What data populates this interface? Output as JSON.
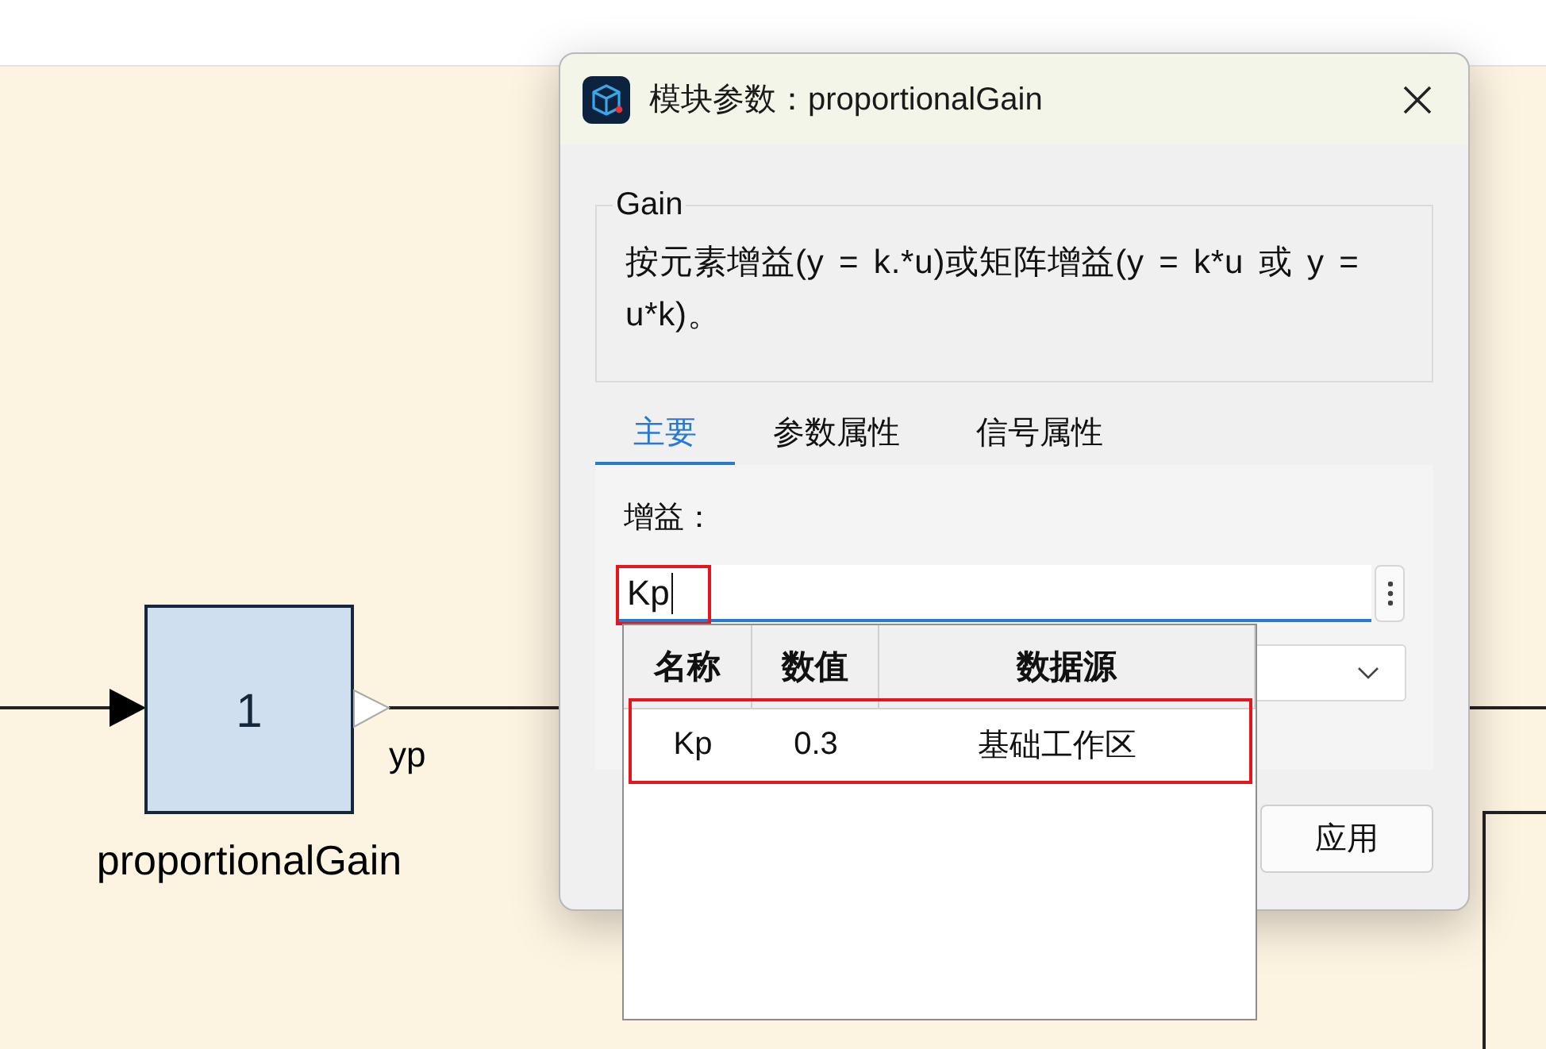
{
  "canvas": {
    "block": {
      "value": "1",
      "name": "proportionalGain",
      "output_label": "yp"
    }
  },
  "dialog": {
    "title": "模块参数：proportionalGain",
    "group": {
      "title": "Gain",
      "description": "按元素增益(y = k.*u)或矩阵增益(y = k*u 或 y = u*k)。"
    },
    "tabs": [
      {
        "label": "主要",
        "selected": true
      },
      {
        "label": "参数属性",
        "selected": false
      },
      {
        "label": "信号属性",
        "selected": false
      }
    ],
    "gain": {
      "label": "增益：",
      "value": "Kp"
    },
    "apply_button": "应用"
  },
  "suggestions": {
    "columns": [
      "名称",
      "数值",
      "数据源"
    ],
    "rows": [
      {
        "cells": [
          "Kp",
          "0.3",
          "基础工作区"
        ]
      }
    ]
  }
}
